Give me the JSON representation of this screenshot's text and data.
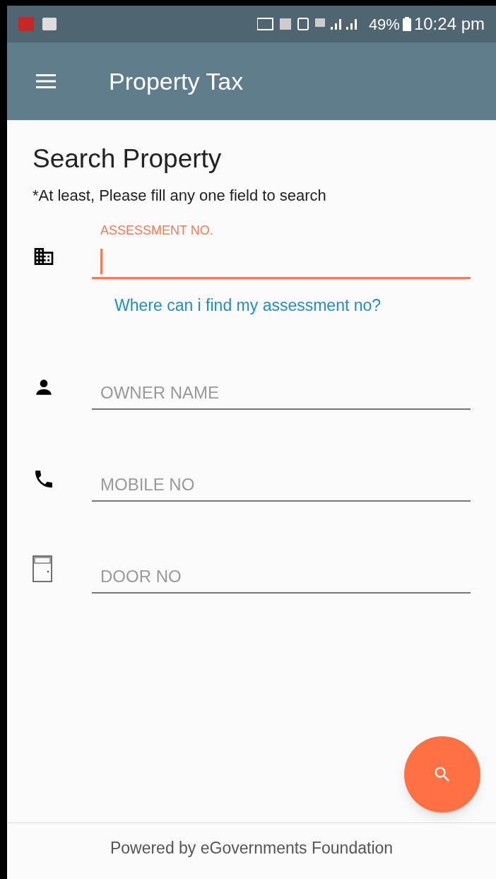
{
  "status_bar": {
    "battery": "49%",
    "time": "10:24 pm"
  },
  "app_bar": {
    "title": "Property Tax"
  },
  "heading": "Search Property",
  "note": "*At least, Please fill any one field to search",
  "fields": [
    {
      "kind": "building",
      "label": "ASSESSMENT NO.",
      "focused": true,
      "help_link": "Where can i find my assessment no?"
    },
    {
      "kind": "person",
      "label": "OWNER NAME",
      "focused": false
    },
    {
      "kind": "phone",
      "label": "MOBILE NO",
      "focused": false
    },
    {
      "kind": "door",
      "label": "DOOR NO",
      "focused": false
    }
  ],
  "footer": "Powered by eGovernments Foundation"
}
